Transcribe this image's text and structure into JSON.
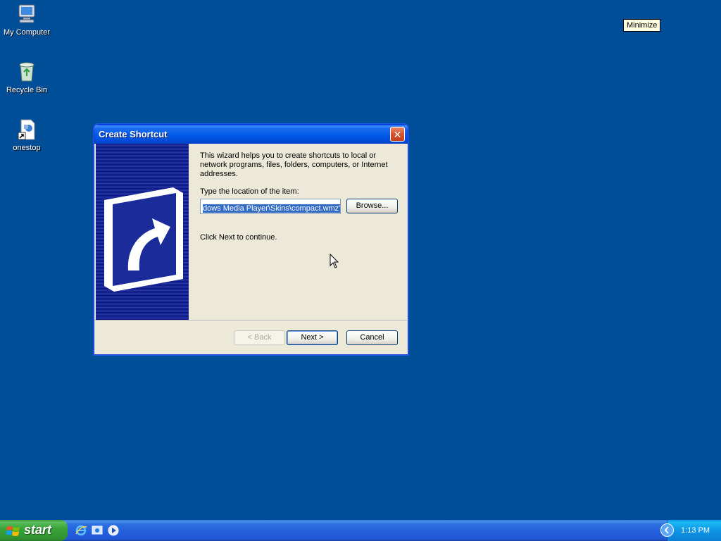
{
  "desktop": {
    "icons": [
      {
        "label": "My Computer"
      },
      {
        "label": "Recycle Bin"
      },
      {
        "label": "onestop"
      }
    ],
    "tooltip": "Minimize"
  },
  "dialog": {
    "title": "Create Shortcut",
    "close_glyph": "✕",
    "intro": "This wizard helps you to create shortcuts to local or network programs, files, folders, computers, or Internet addresses.",
    "location_label": "Type the location of the item:",
    "location_value": "dows Media Player\\Skins\\compact.wmz\"",
    "browse_label": "Browse...",
    "continue_text": "Click Next to continue.",
    "back_label": "< Back",
    "next_label": "Next >",
    "cancel_label": "Cancel"
  },
  "taskbar": {
    "start_label": "start",
    "clock": "1:13 PM",
    "quick_launch": [
      "internet-explorer-icon",
      "show-desktop-icon",
      "media-player-icon"
    ]
  },
  "colors": {
    "desktop": "#004e98",
    "titlebar": "#0058e6",
    "dialog_bg": "#ece9d8",
    "selection": "#316ac5",
    "start": "#3aa53a"
  }
}
